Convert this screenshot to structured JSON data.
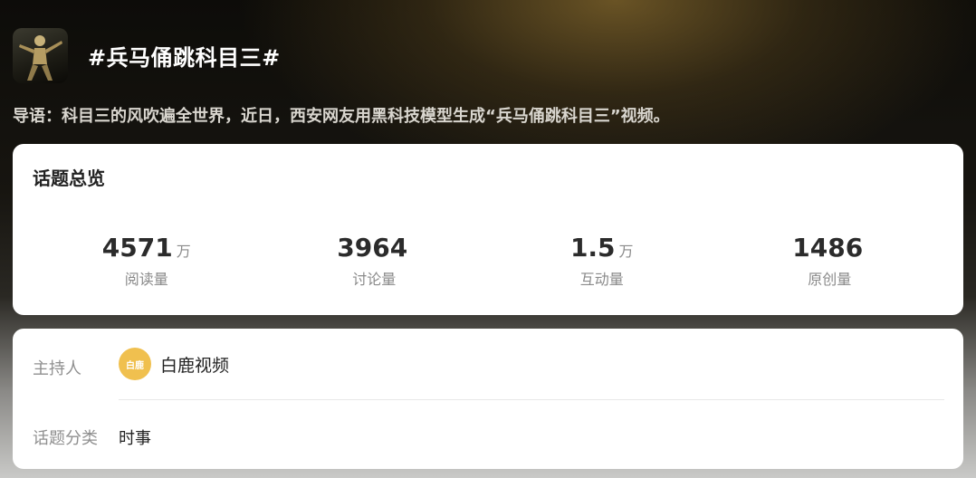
{
  "topic": {
    "title": "#兵马俑跳科目三#",
    "intro": "导语：科目三的风吹遍全世界，近日，西安网友用黑科技模型生成“兵马俑跳科目三”视频。",
    "thumbnail_icon": "dancer-thumbnail-icon"
  },
  "overview": {
    "title": "话题总览",
    "stats": [
      {
        "value": "4571",
        "unit": "万",
        "label": "阅读量"
      },
      {
        "value": "3964",
        "unit": "",
        "label": "讨论量"
      },
      {
        "value": "1.5",
        "unit": "万",
        "label": "互动量"
      },
      {
        "value": "1486",
        "unit": "",
        "label": "原创量"
      }
    ]
  },
  "info": {
    "host_label": "主持人",
    "host_name": "白鹿视频",
    "host_avatar_text": "白鹿",
    "category_label": "话题分类",
    "category_value": "时事"
  },
  "colors": {
    "avatar": "#f0c04f",
    "card": "#ffffff",
    "accent_bg": "#7a602a"
  }
}
